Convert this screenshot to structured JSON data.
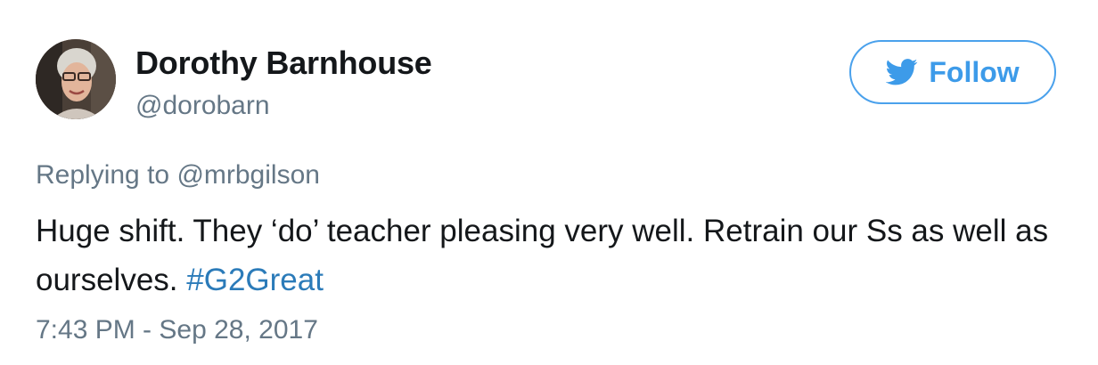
{
  "author": {
    "display_name": "Dorothy Barnhouse",
    "handle": "@dorobarn"
  },
  "follow_button": {
    "label": "Follow",
    "icon": "twitter-bird-icon",
    "color": "#3d9be9"
  },
  "reply": {
    "prefix": "Replying to ",
    "target": "@mrbgilson"
  },
  "tweet": {
    "text": "Huge shift. They ‘do’ teacher pleasing very well. Retrain our Ss as well as ourselves. ",
    "hashtag": "#G2Great",
    "hashtag_color": "#2b7bb9"
  },
  "timestamp": "7:43 PM - Sep 28, 2017"
}
